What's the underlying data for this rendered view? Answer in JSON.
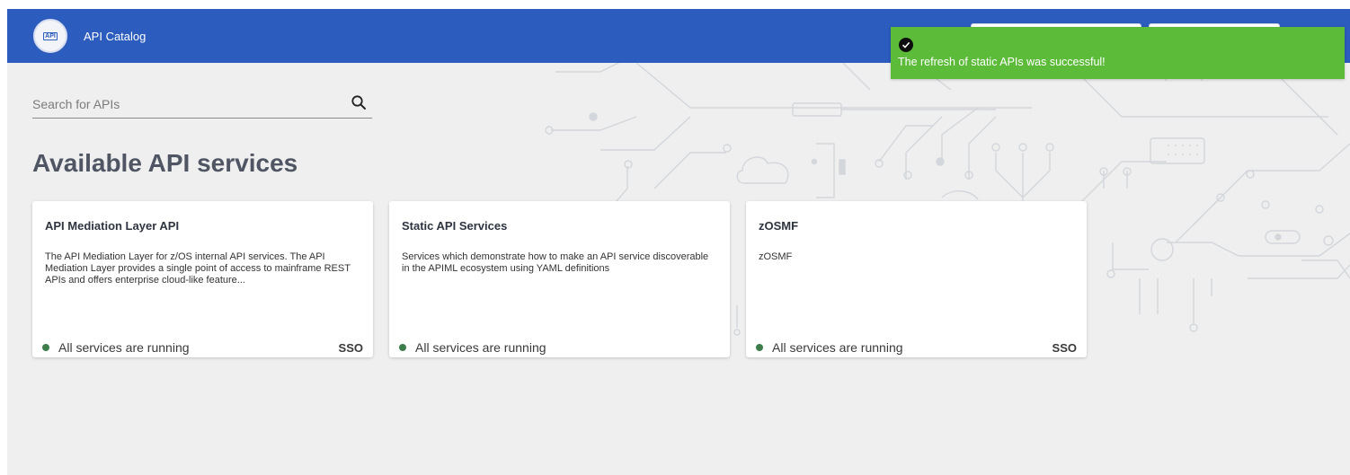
{
  "app": {
    "title": "API Catalog",
    "logo_text": "API"
  },
  "colors": {
    "header": "#2c5cbd",
    "toast": "#5dbb3a",
    "status_ok": "#3c7d4a"
  },
  "notification": {
    "message": "The refresh of static APIs was successful!",
    "icon": "check-circle-icon"
  },
  "search": {
    "placeholder": "Search for APIs",
    "value": "",
    "icon": "search-icon"
  },
  "page": {
    "title": "Available API services"
  },
  "cards": [
    {
      "title": "API Mediation Layer API",
      "description": "The API Mediation Layer for z/OS internal API services. The API Mediation Layer provides a single point of access to mainframe REST APIs and offers enterprise cloud-like feature...",
      "status": "All services are running",
      "badge": "SSO"
    },
    {
      "title": "Static API Services",
      "description": "Services which demonstrate how to make an API service discoverable in the APIML ecosystem using YAML definitions",
      "status": "All services are running",
      "badge": ""
    },
    {
      "title": "zOSMF",
      "description": "zOSMF",
      "status": "All services are running",
      "badge": "SSO"
    }
  ]
}
